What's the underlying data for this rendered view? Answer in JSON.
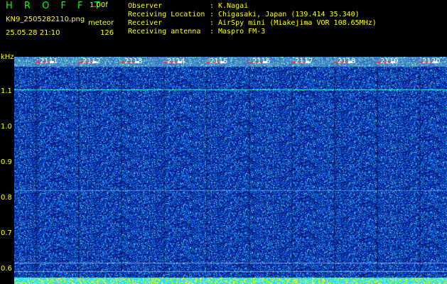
{
  "header": {
    "app_title": "H R O F F T",
    "version": "1.00f",
    "filename": "KN9_2505282110.png",
    "meteor_label": "meteor",
    "datetime": "25.05.28 21:10",
    "count": "126"
  },
  "info": [
    {
      "key": "Observer",
      "value": "K.Nagai"
    },
    {
      "key": "Receiving Location",
      "value": "Chigasaki, Japan (139.414 35.340)"
    },
    {
      "key": "Receiver",
      "value": "AirSpy mini (Miakejima VOR 108.65MHz)"
    },
    {
      "key": "Receiving antenna",
      "value": "Maspro FM-3"
    }
  ],
  "y_axis": {
    "unit": "kHz",
    "ticks": [
      "1.1",
      "1.0",
      "0.9",
      "0.8",
      "0.7",
      "0.6"
    ]
  },
  "time_labels": [
    "2111",
    "2112",
    "2113",
    "2114",
    "2115",
    "2116",
    "2117",
    "2118",
    "2119",
    "2120"
  ],
  "colors": {
    "background": "#000000",
    "text_yellow": "#ffff00",
    "title_green": "#00ff00",
    "noise_base": "#0a2a9a",
    "signal_cyan": "#33ffcc"
  }
}
